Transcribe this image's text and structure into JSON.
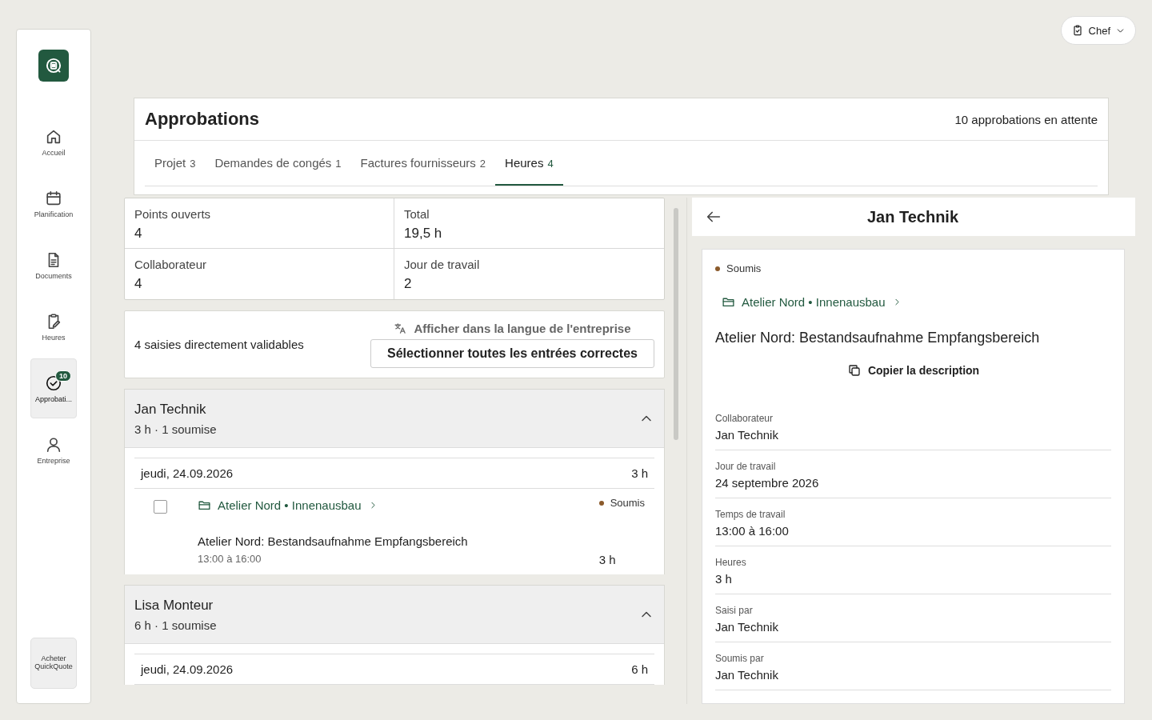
{
  "nav": {
    "items": [
      {
        "label": "Accueil",
        "kind": "home",
        "selected": false
      },
      {
        "label": "Planification",
        "kind": "calendar",
        "selected": false
      },
      {
        "label": "Documents",
        "kind": "document",
        "selected": false
      },
      {
        "label": "Heures",
        "kind": "clipboard",
        "selected": false
      },
      {
        "label": "Approbati...",
        "kind": "check",
        "selected": true,
        "badge": "10"
      },
      {
        "label": "Entreprise",
        "kind": "user",
        "selected": false
      }
    ],
    "buy_button": "Acheter QuickQuote"
  },
  "role_menu": {
    "label": "Chef"
  },
  "page": {
    "title": "Approbations",
    "pending": "10 approbations en attente"
  },
  "tabs": [
    {
      "label": "Projet",
      "count": "3",
      "selected": false
    },
    {
      "label": "Demandes de congés",
      "count": "1",
      "selected": false
    },
    {
      "label": "Factures fournisseurs",
      "count": "2",
      "selected": false
    },
    {
      "label": "Heures",
      "count": "4",
      "selected": true
    }
  ],
  "stats": [
    {
      "label": "Points ouverts",
      "value": "4"
    },
    {
      "label": "Total",
      "value": "19,5 h"
    },
    {
      "label": "Collaborateur",
      "value": "4"
    },
    {
      "label": "Jour de travail",
      "value": "2"
    }
  ],
  "bulk": {
    "text": "4 saisies directement validables",
    "translate": "Afficher dans la langue de l'entreprise",
    "select_all": "Sélectionner toutes les entrées correctes"
  },
  "groups": [
    {
      "name": "Jan Technik",
      "summary": "3 h · 1 soumise",
      "expanded": true,
      "days": [
        {
          "date": "jeudi, 24.09.2026",
          "total": "3 h",
          "entries": [
            {
              "checked": false,
              "status": "Soumis",
              "color": "#8b5a2b",
              "project": "Atelier Nord • Innenausbau",
              "description": "Atelier Nord: Bestandsaufnahme Empfangsbereich",
              "time": "13:00 à 16:00",
              "hours": "3 h"
            }
          ]
        }
      ]
    },
    {
      "name": "Lisa Monteur",
      "summary": "6 h · 1 soumise",
      "expanded": true,
      "days": [
        {
          "date": "jeudi, 24.09.2026",
          "total": "6 h"
        }
      ]
    }
  ],
  "detail": {
    "title": "Jan Technik",
    "status": "Soumis",
    "color": "#8b5a2b",
    "project": "Atelier Nord • Innenausbau",
    "description": "Atelier Nord: Bestandsaufnahme Empfangsbereich",
    "copy": "Copier la description",
    "fields": [
      {
        "label": "Collaborateur",
        "value": "Jan Technik"
      },
      {
        "label": "Jour de travail",
        "value": "24 septembre 2026"
      },
      {
        "label": "Temps de travail",
        "value": "13:00 à 16:00"
      },
      {
        "label": "Heures",
        "value": "3 h"
      },
      {
        "label": "Saisi par",
        "value": "Jan Technik"
      },
      {
        "label": "Soumis par",
        "value": "Jan Technik"
      }
    ]
  }
}
